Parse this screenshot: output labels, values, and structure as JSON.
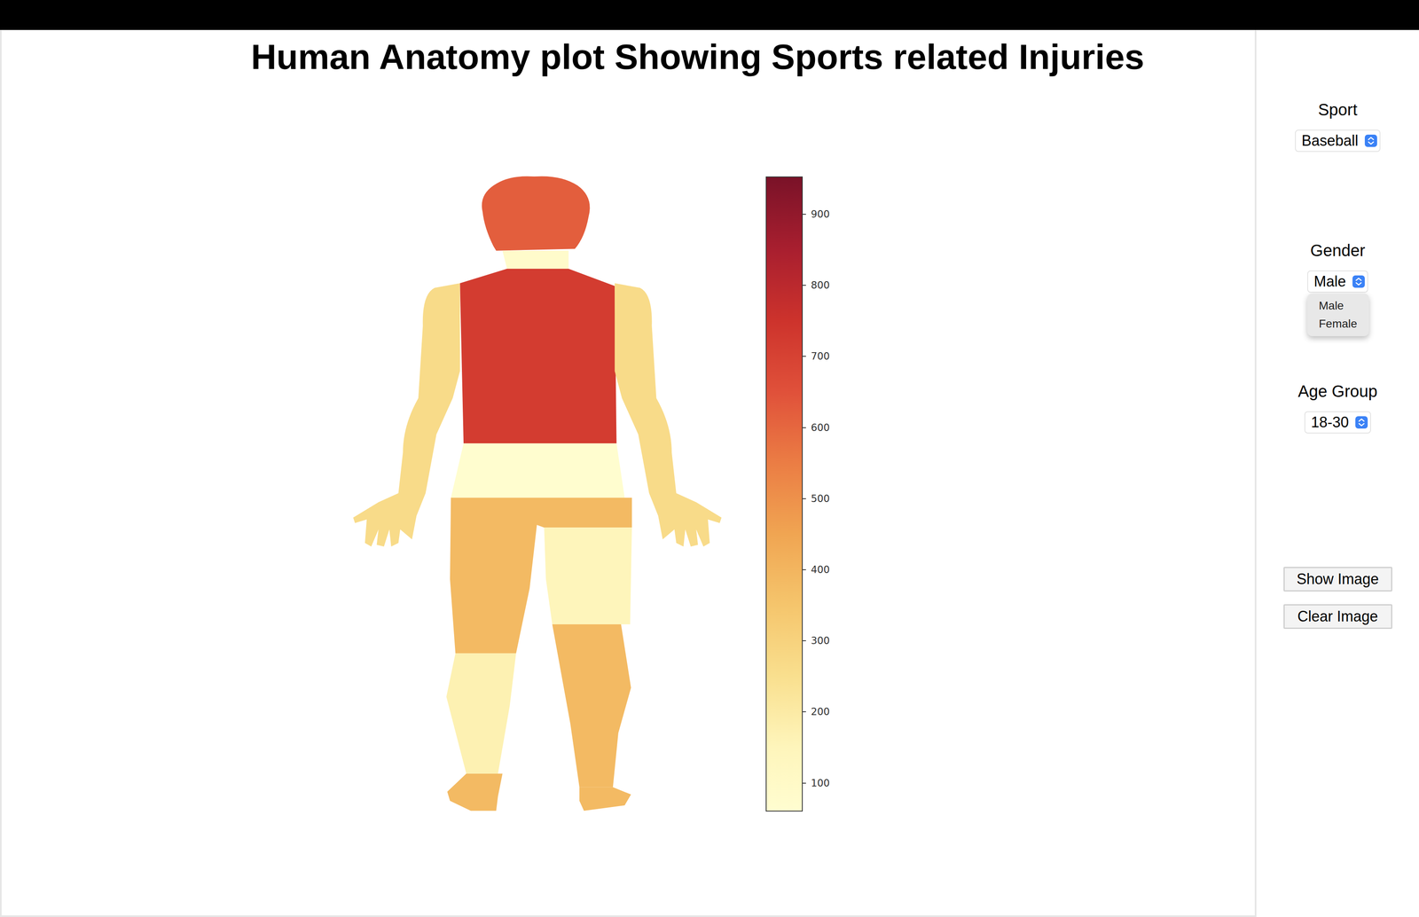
{
  "title": "Human Anatomy plot Showing Sports related Injuries",
  "controls": [
    {
      "label": "Sport",
      "value": "Baseball",
      "open": false,
      "options": []
    },
    {
      "label": "Gender",
      "value": "Male",
      "open": true,
      "options": [
        "Male",
        "Female"
      ]
    },
    {
      "label": "Age Group",
      "value": "18-30",
      "open": false,
      "options": []
    }
  ],
  "buttons": [
    "Show Image",
    "Clear Image"
  ],
  "chart": {
    "range": [
      60,
      953
    ],
    "ticks": [
      "100",
      "200",
      "300",
      "400",
      "500",
      "600",
      "700",
      "800",
      "900"
    ],
    "regions": [
      {
        "part": "head",
        "value": 620
      },
      {
        "part": "neck",
        "value": 80
      },
      {
        "part": "torso",
        "value": 720
      },
      {
        "part": "left-arm",
        "value": 265
      },
      {
        "part": "right-arm",
        "value": 265
      },
      {
        "part": "hips",
        "value": 65
      },
      {
        "part": "left-upper-leg",
        "value": 385
      },
      {
        "part": "right-upper-leg",
        "value": 150
      },
      {
        "part": "left-lower-leg",
        "value": 170
      },
      {
        "part": "right-lower-leg",
        "value": 385
      },
      {
        "part": "left-foot",
        "value": 385
      },
      {
        "part": "right-foot",
        "value": 385
      }
    ]
  }
}
